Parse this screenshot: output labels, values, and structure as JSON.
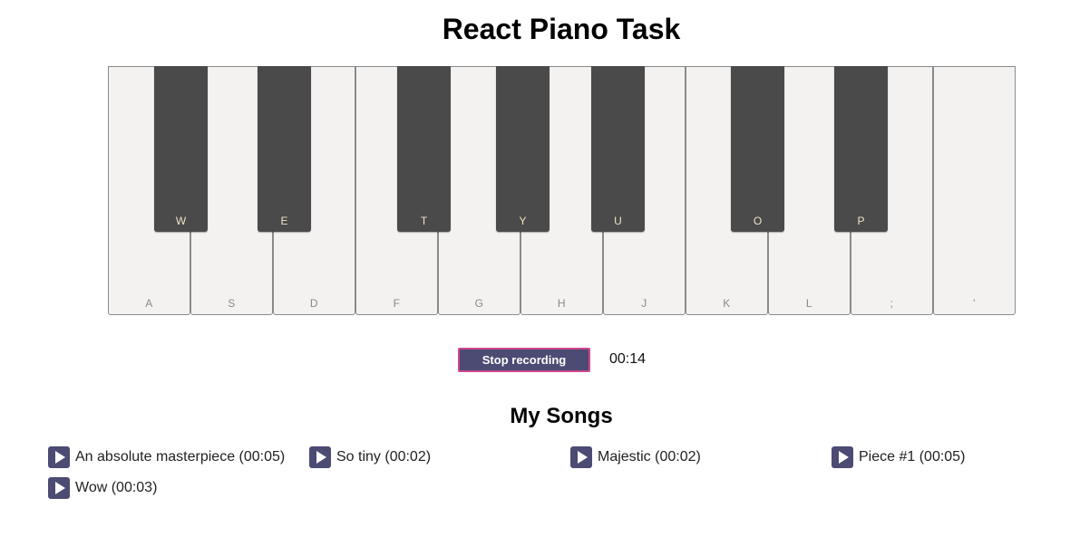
{
  "title": "React Piano Task",
  "piano": {
    "white_keys": [
      "A",
      "S",
      "D",
      "F",
      "G",
      "H",
      "J",
      "K",
      "L",
      ";",
      "'"
    ],
    "black_keys": [
      "W",
      "E",
      "T",
      "Y",
      "U",
      "O",
      "P"
    ]
  },
  "recorder": {
    "button_label": "Stop recording",
    "elapsed": "00:14"
  },
  "songs": {
    "heading": "My Songs",
    "items": [
      {
        "title": "An absolute masterpiece (00:05)",
        "icon": "play-icon"
      },
      {
        "title": "So tiny (00:02)",
        "icon": "play-icon"
      },
      {
        "title": "Majestic (00:02)",
        "icon": "play-icon"
      },
      {
        "title": "Piece #1 (00:05)",
        "icon": "play-icon"
      },
      {
        "title": "Wow (00:03)",
        "icon": "play-icon"
      }
    ]
  },
  "colors": {
    "accent": "#4c4b73",
    "accent_border": "#d0468e",
    "white_key": "#f3f2f0",
    "black_key": "#4a4a4a"
  }
}
